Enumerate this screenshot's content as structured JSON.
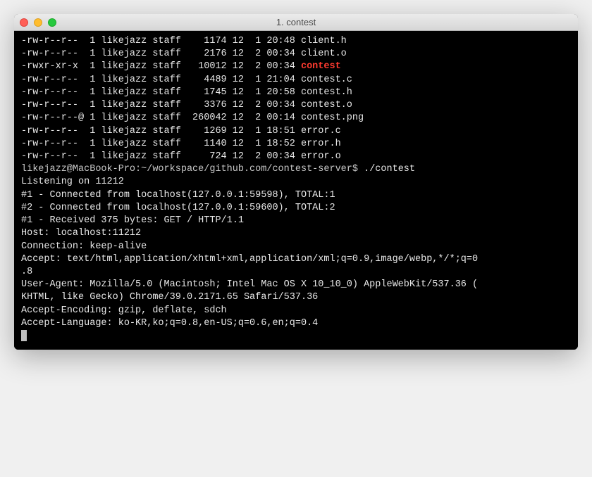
{
  "window": {
    "title": "1. contest"
  },
  "ls": [
    {
      "perm": "-rw-r--r--",
      "at": " ",
      "links": "1",
      "owner": "likejazz",
      "group": "staff",
      "size": "1174",
      "mon": "12",
      "day": " 1",
      "time": "20:48",
      "name": "client.h",
      "hl": false
    },
    {
      "perm": "-rw-r--r--",
      "at": " ",
      "links": "1",
      "owner": "likejazz",
      "group": "staff",
      "size": "2176",
      "mon": "12",
      "day": " 2",
      "time": "00:34",
      "name": "client.o",
      "hl": false
    },
    {
      "perm": "-rwxr-xr-x",
      "at": " ",
      "links": "1",
      "owner": "likejazz",
      "group": "staff",
      "size": "10012",
      "mon": "12",
      "day": " 2",
      "time": "00:34",
      "name": "contest",
      "hl": true
    },
    {
      "perm": "-rw-r--r--",
      "at": " ",
      "links": "1",
      "owner": "likejazz",
      "group": "staff",
      "size": "4489",
      "mon": "12",
      "day": " 1",
      "time": "21:04",
      "name": "contest.c",
      "hl": false
    },
    {
      "perm": "-rw-r--r--",
      "at": " ",
      "links": "1",
      "owner": "likejazz",
      "group": "staff",
      "size": "1745",
      "mon": "12",
      "day": " 1",
      "time": "20:58",
      "name": "contest.h",
      "hl": false
    },
    {
      "perm": "-rw-r--r--",
      "at": " ",
      "links": "1",
      "owner": "likejazz",
      "group": "staff",
      "size": "3376",
      "mon": "12",
      "day": " 2",
      "time": "00:34",
      "name": "contest.o",
      "hl": false
    },
    {
      "perm": "-rw-r--r--",
      "at": "@",
      "links": "1",
      "owner": "likejazz",
      "group": "staff",
      "size": "260042",
      "mon": "12",
      "day": " 2",
      "time": "00:14",
      "name": "contest.png",
      "hl": false
    },
    {
      "perm": "-rw-r--r--",
      "at": " ",
      "links": "1",
      "owner": "likejazz",
      "group": "staff",
      "size": "1269",
      "mon": "12",
      "day": " 1",
      "time": "18:51",
      "name": "error.c",
      "hl": false
    },
    {
      "perm": "-rw-r--r--",
      "at": " ",
      "links": "1",
      "owner": "likejazz",
      "group": "staff",
      "size": "1140",
      "mon": "12",
      "day": " 1",
      "time": "18:52",
      "name": "error.h",
      "hl": false
    },
    {
      "perm": "-rw-r--r--",
      "at": " ",
      "links": "1",
      "owner": "likejazz",
      "group": "staff",
      "size": "724",
      "mon": "12",
      "day": " 2",
      "time": "00:34",
      "name": "error.o",
      "hl": false
    }
  ],
  "prompt": {
    "text": "likejazz@MacBook-Pro:~/workspace/github.com/contest-server$ ",
    "command": "./contest"
  },
  "output": [
    "Listening on 11212",
    "#1 - Connected from localhost(127.0.0.1:59598), TOTAL:1",
    "#2 - Connected from localhost(127.0.0.1:59600), TOTAL:2",
    "#1 - Received 375 bytes: GET / HTTP/1.1",
    "Host: localhost:11212",
    "Connection: keep-alive",
    "Accept: text/html,application/xhtml+xml,application/xml;q=0.9,image/webp,*/*;q=0.8",
    "User-Agent: Mozilla/5.0 (Macintosh; Intel Mac OS X 10_10_0) AppleWebKit/537.36 (KHTML, like Gecko) Chrome/39.0.2171.65 Safari/537.36",
    "Accept-Encoding: gzip, deflate, sdch",
    "Accept-Language: ko-KR,ko;q=0.8,en-US;q=0.6,en;q=0.4"
  ]
}
